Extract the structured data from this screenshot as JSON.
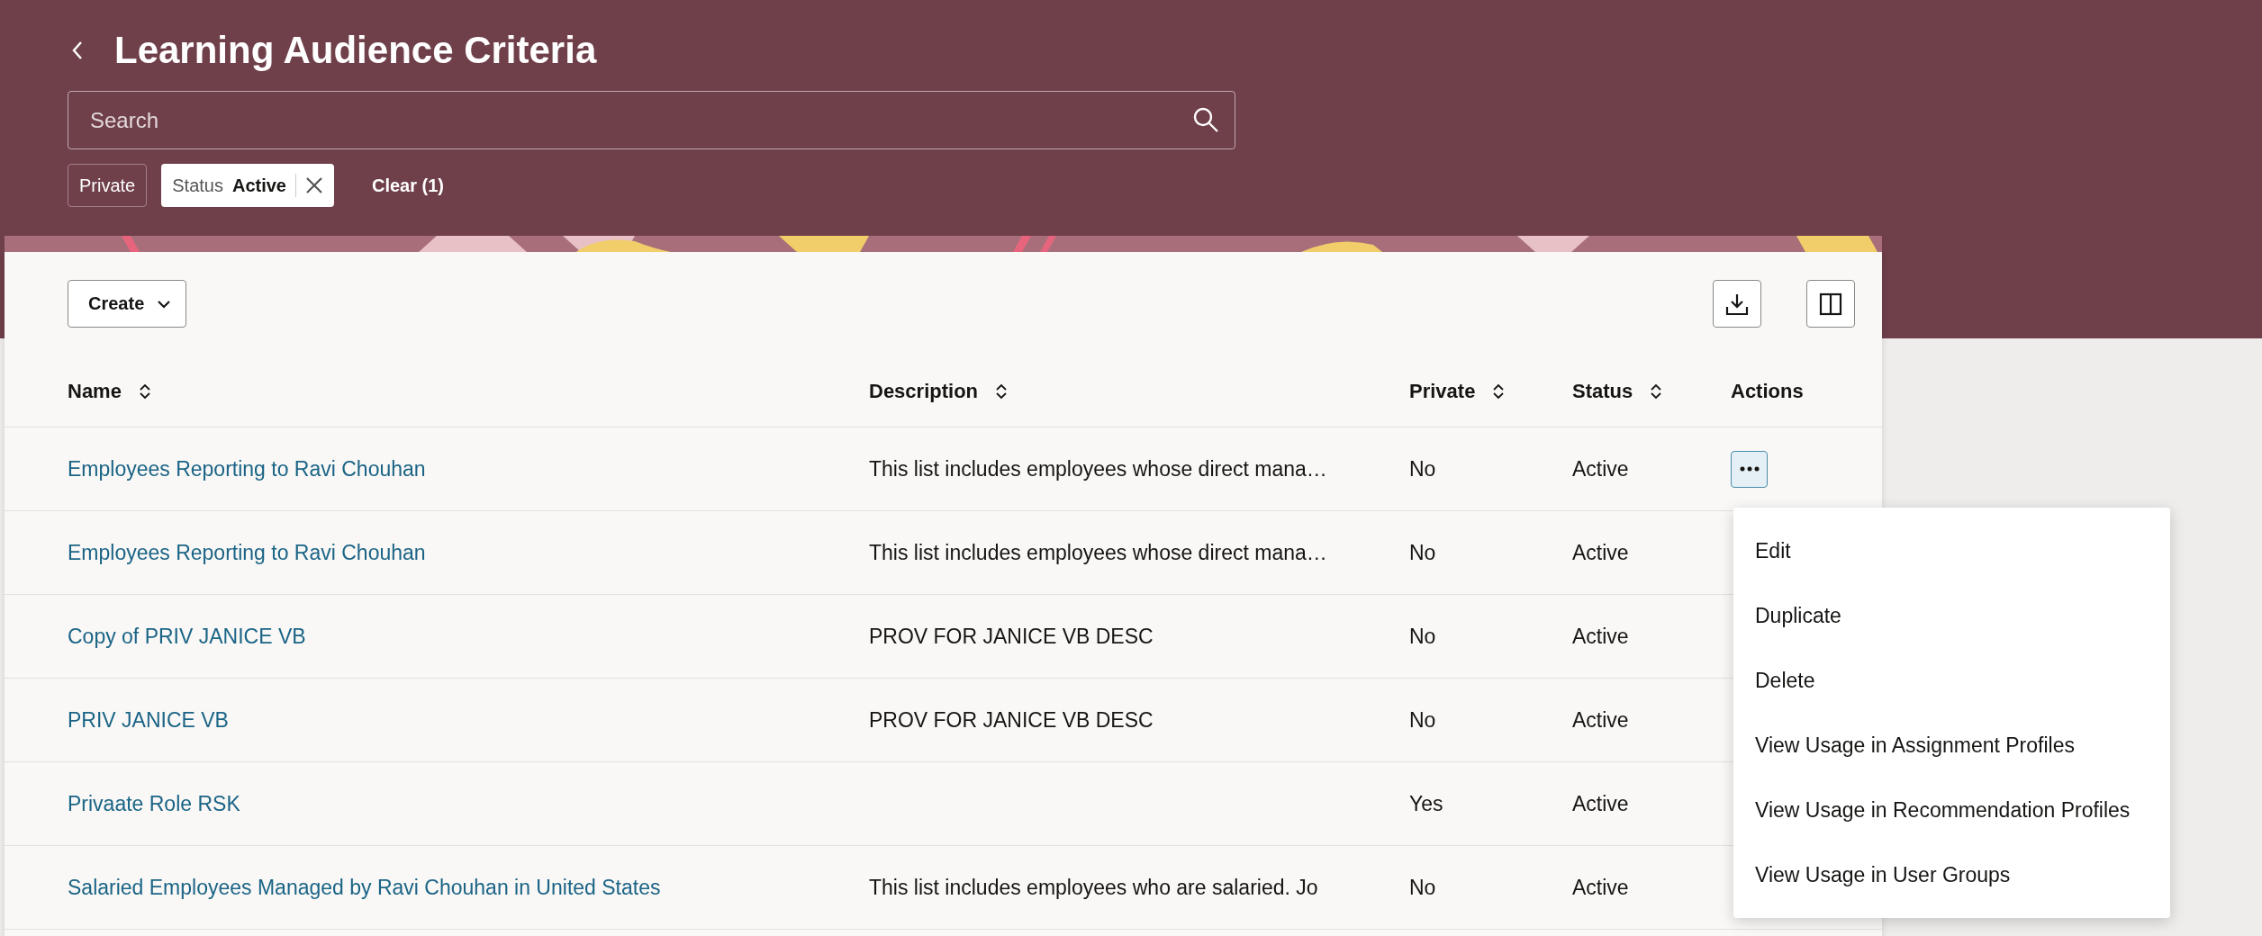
{
  "header": {
    "title": "Learning Audience Criteria"
  },
  "search": {
    "placeholder": "Search"
  },
  "filters": [
    {
      "kind": "option",
      "label": "Private"
    },
    {
      "kind": "applied",
      "label": "Status",
      "value": "Active"
    }
  ],
  "clear_label": "Clear (1)",
  "toolbar": {
    "create_label": "Create"
  },
  "table": {
    "columns": [
      {
        "label": "Name",
        "sortable": true
      },
      {
        "label": "Description",
        "sortable": true
      },
      {
        "label": "Private",
        "sortable": true
      },
      {
        "label": "Status",
        "sortable": true
      },
      {
        "label": "Actions",
        "sortable": false
      }
    ],
    "rows": [
      {
        "name": "Employees Reporting to Ravi Chouhan",
        "description": "This list includes employees whose direct mana…",
        "private": "No",
        "status": "Active",
        "menu_open": true
      },
      {
        "name": "Employees Reporting to Ravi Chouhan",
        "description": "This list includes employees whose direct mana…",
        "private": "No",
        "status": "Active",
        "menu_open": false
      },
      {
        "name": "Copy of PRIV JANICE VB",
        "description": "PROV FOR JANICE VB DESC",
        "private": "No",
        "status": "Active",
        "menu_open": false
      },
      {
        "name": "PRIV JANICE VB",
        "description": "PROV FOR JANICE VB DESC",
        "private": "No",
        "status": "Active",
        "menu_open": false
      },
      {
        "name": "Privaate Role RSK",
        "description": "",
        "private": "Yes",
        "status": "Active",
        "menu_open": false
      },
      {
        "name": "Salaried Employees Managed by Ravi Chouhan in United States",
        "description": "This list includes employees who are salaried. Jo",
        "private": "No",
        "status": "Active",
        "menu_open": false
      }
    ]
  },
  "action_menu": {
    "items": [
      "Edit",
      "Duplicate",
      "Delete",
      "View Usage in Assignment Profiles",
      "View Usage in Recommendation Profiles",
      "View Usage in User Groups"
    ]
  }
}
